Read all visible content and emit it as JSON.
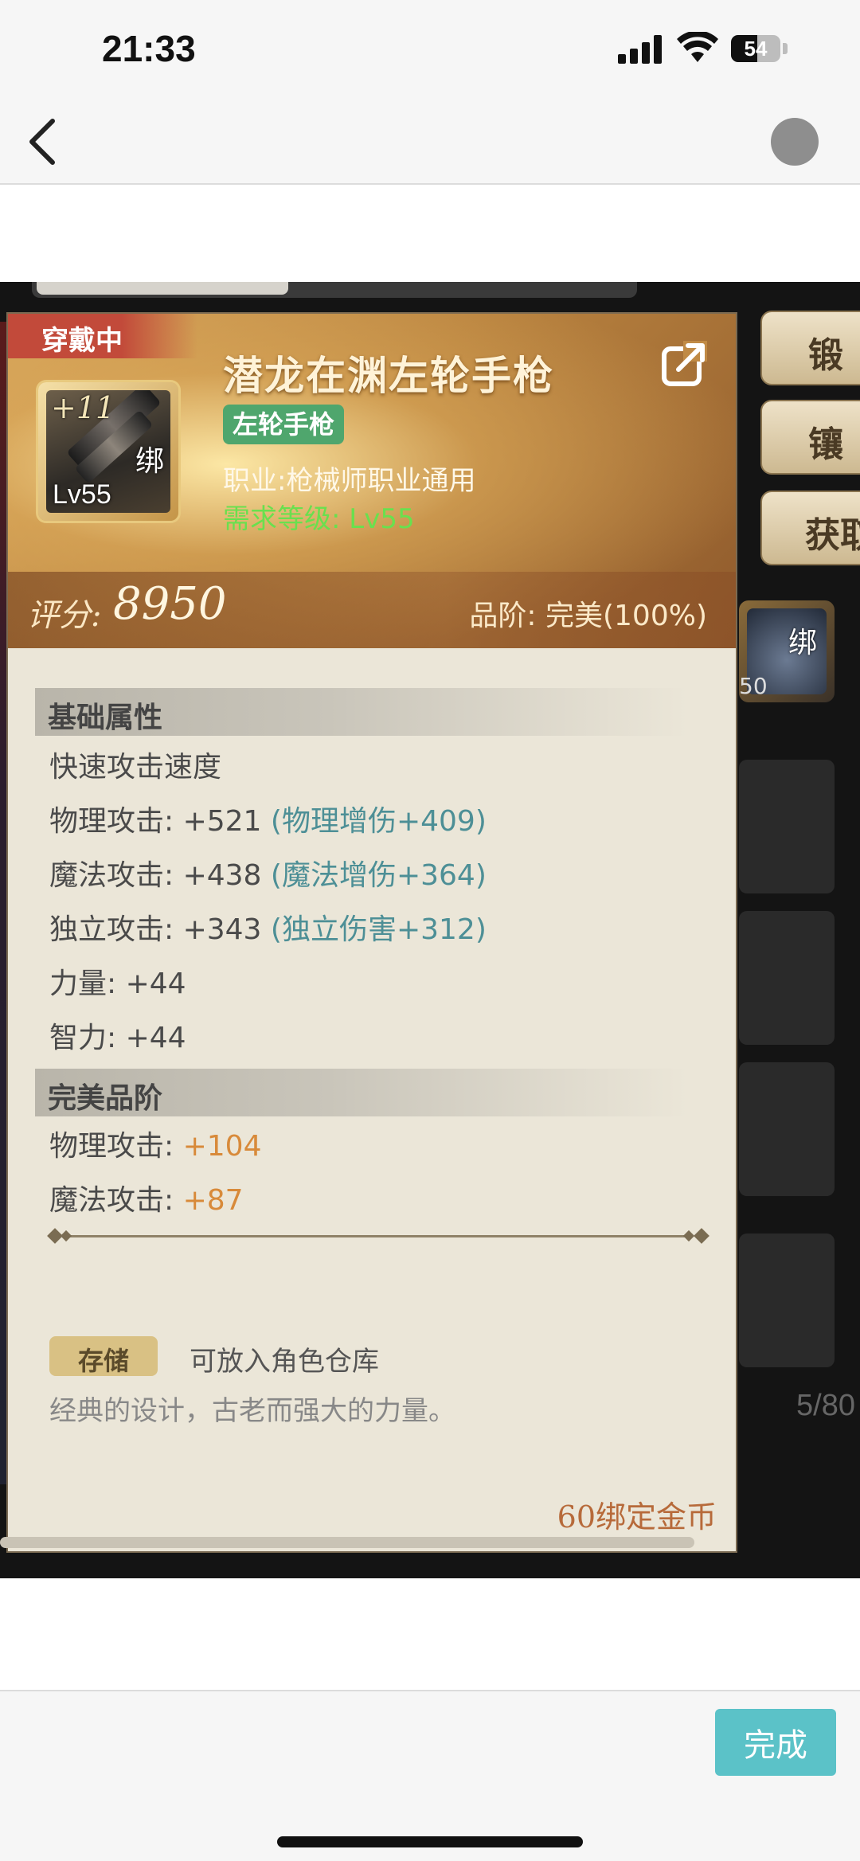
{
  "status_bar": {
    "time": "21:33",
    "battery": "54",
    "battery_level": 0.54
  },
  "nav": {
    "back_icon": "chevron-left-icon",
    "avatar": "avatar"
  },
  "game": {
    "side_buttons": [
      "锻",
      "镶",
      "获取"
    ],
    "side_item": {
      "bind": "绑",
      "level": "50"
    },
    "side_count": "5/80"
  },
  "card": {
    "wearing": "穿戴中",
    "icon": {
      "plus": "+11",
      "bind": "绑",
      "level": "Lv55"
    },
    "name": "潜龙在渊左轮手枪",
    "type": "左轮手枪",
    "job": "职业:枪械师职业通用",
    "requirement": "需求等级:  Lv55",
    "score_label": "评分:",
    "score": "8950",
    "grade": "品阶:  完美(100%)",
    "sections": {
      "base_title": "基础属性",
      "perfect_title": "完美品阶"
    },
    "base_attrs": [
      {
        "text": "快速攻击速度",
        "bonus": ""
      },
      {
        "text": "物理攻击:  +521",
        "bonus": "(物理增伤+409)"
      },
      {
        "text": "魔法攻击:  +438",
        "bonus": "(魔法增伤+364)"
      },
      {
        "text": "独立攻击:  +343",
        "bonus": "(独立伤害+312)"
      },
      {
        "text": "力量:  +44",
        "bonus": ""
      },
      {
        "text": "智力:  +44",
        "bonus": ""
      }
    ],
    "perfect_attrs": [
      {
        "label": "物理攻击:",
        "value": "+104"
      },
      {
        "label": "魔法攻击:",
        "value": "+87"
      }
    ],
    "store_tag": "存储",
    "store_text": "可放入角色仓库",
    "description": "经典的设计，古老而强大的力量。",
    "price": "60绑定金币"
  },
  "footer": {
    "done_label": "完成",
    "done_color": "#5bc2c8"
  }
}
